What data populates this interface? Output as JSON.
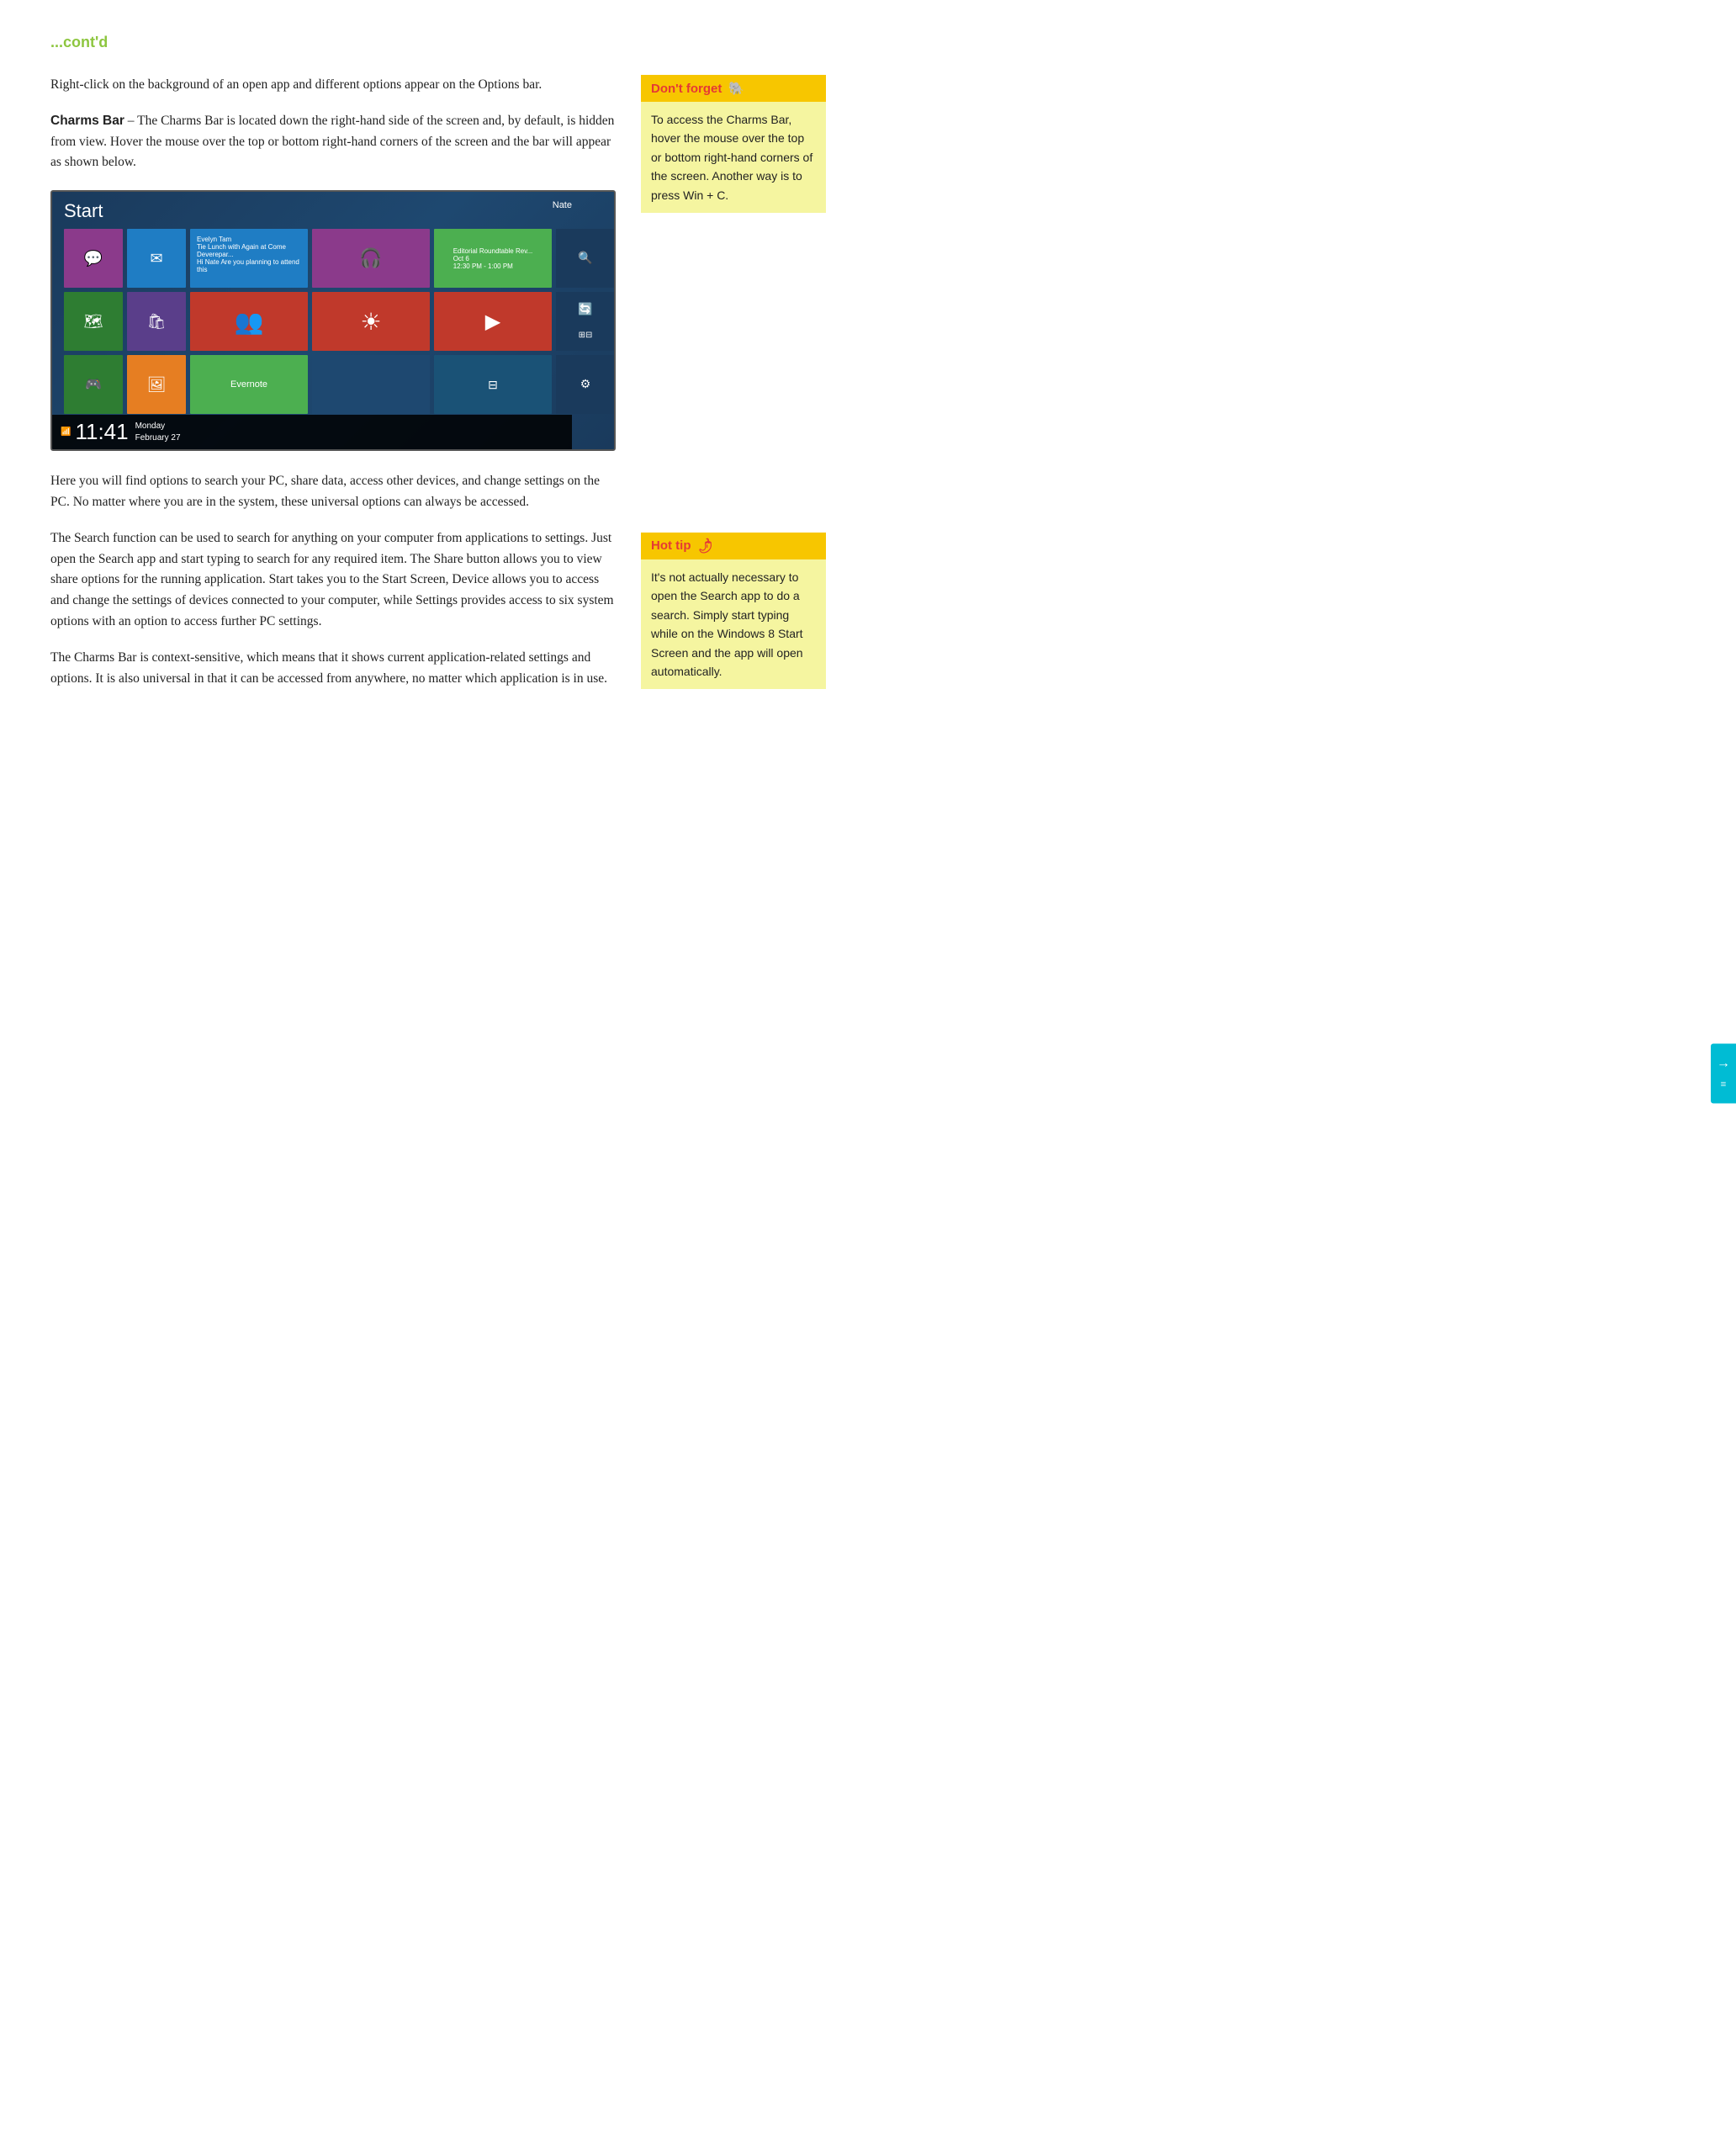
{
  "header": {
    "contd": "...cont'd"
  },
  "intro_text": "Right-click on the background of an open app and different options appear on the Options bar.",
  "charms_bar_label": "Charms Bar",
  "charms_bar_text": "– The Charms Bar is located down the right-hand side of the screen and, by default, is hidden from view. Hover the mouse over the top or bottom right-hand corners of the screen and the bar will appear as shown below.",
  "screenshot": {
    "start_text": "Start",
    "user_name": "Nate",
    "time": "11:41",
    "day": "Monday",
    "date": "February 27"
  },
  "paragraph2": "Here you will find options to search your PC, share data, access other devices, and change settings on the PC.  No matter where you are in the system, these universal options can always be accessed.",
  "paragraph3": "The Search function can be used to search for anything on your computer from applications to settings. Just open the Search app and start typing to search for any required item. The Share button allows you to view share options for the running application. Start takes you to the Start Screen, Device allows you to access and change the settings of devices connected to your computer, while Settings provides access to six system options with an option to access further PC settings.",
  "paragraph4": "The Charms Bar is context-sensitive, which means that it shows current application-related settings and options. It is also universal in that it can be accessed from anywhere, no matter which application is in use.",
  "dont_forget": {
    "header": "Don't forget",
    "content": "To access the Charms Bar, hover the mouse over the top or bottom right-hand corners of the screen. Another way is to press Win + C."
  },
  "hot_tip": {
    "header": "Hot tip",
    "content": "It's not actually necessary to open the Search app to do a search. Simply start typing while on the Windows 8 Start Screen and the app will open automatically."
  }
}
